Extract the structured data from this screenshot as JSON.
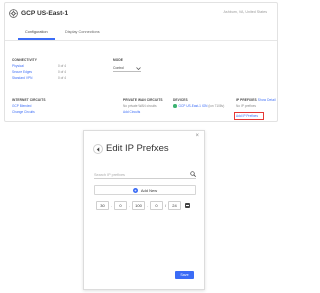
{
  "site": {
    "title": "GCP US-East-1",
    "location": "Ashburn, VA, United States"
  },
  "tabs": [
    {
      "label": "Configuration",
      "active": true
    },
    {
      "label": "Display Connections",
      "active": false
    }
  ],
  "connectivity": {
    "label": "CONNECTIVITY",
    "rows": [
      {
        "name": "Physical",
        "count": "0 of 4"
      },
      {
        "name": "Secure Edges",
        "count": "0 of 4"
      },
      {
        "name": "Standard VPN",
        "count": "0 of 4"
      }
    ]
  },
  "mode": {
    "label": "MODE",
    "value": "Control"
  },
  "internet_circuits": {
    "label": "INTERNET CIRCUITS",
    "items": [
      "GCP Blended",
      "Change Circuits"
    ]
  },
  "private_wan": {
    "label": "PRIVATE WAN CIRCUITS",
    "items": [
      "No private WAN circuits",
      "Add Circuits"
    ]
  },
  "devices": {
    "label": "DEVICES",
    "device_name": "GCP US-East-1 ION",
    "device_model": "(ion 7108v)",
    "status_color": "#3cb371"
  },
  "ip_prefixes": {
    "label": "IP PREFIXES",
    "label_link": "Show Detail",
    "count_text": "No IP prefixes",
    "add_link": "Add IP Prefixes"
  },
  "modal": {
    "title": "Edit IP Prefxes",
    "search_placeholder": "Search IP prefixes",
    "add_new_label": "Add New",
    "ip": {
      "octets": [
        "30",
        "0",
        "100",
        "0"
      ],
      "cidr": "24"
    },
    "save_label": "Save",
    "close_glyph": "×"
  },
  "colors": {
    "accent": "#3b6cf6",
    "highlight_border": "#e53935",
    "status_online": "#3cb371"
  },
  "icons": [
    "gear-icon",
    "chevron-down-icon",
    "back-arrow-icon",
    "search-icon",
    "plus-circle-icon",
    "remove-icon",
    "close-icon"
  ]
}
